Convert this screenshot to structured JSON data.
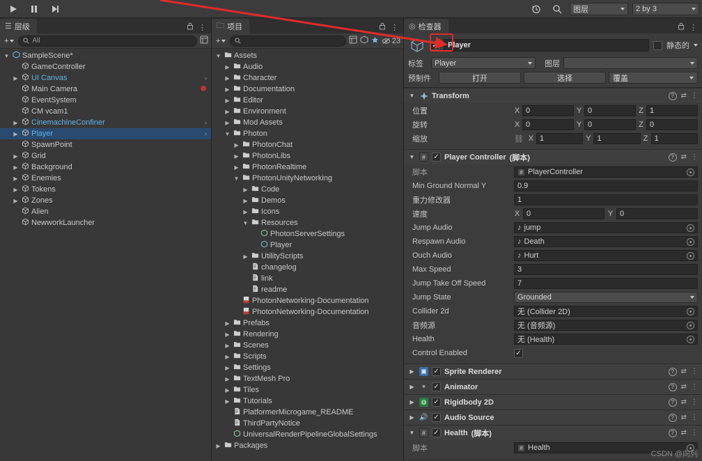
{
  "toolbar": {
    "play_icon": "play-icon",
    "pause_icon": "pause-icon",
    "step_icon": "step-icon",
    "history_icon": "history-icon",
    "search_icon": "search-icon",
    "layers_label": "图层",
    "layout_label": "2 by 3"
  },
  "hierarchy": {
    "tab_label": "层级",
    "tab_icon": "hierarchy-icon",
    "add_label": "+",
    "search_placeholder": "All",
    "lock_icon": "lock-icon",
    "menu_icon": "menu-icon",
    "items": [
      {
        "label": "SampleScene*",
        "depth": 0,
        "arrow": "▼",
        "icon": "scene-icon",
        "selected": false,
        "blue": false
      },
      {
        "label": "GameController",
        "depth": 1,
        "arrow": "",
        "icon": "cube-icon",
        "selected": false,
        "blue": false
      },
      {
        "label": "UI Canvas",
        "depth": 1,
        "arrow": "▶",
        "icon": "cube-icon",
        "selected": false,
        "blue": true
      },
      {
        "label": "Main Camera",
        "depth": 1,
        "arrow": "",
        "icon": "cube-icon",
        "selected": false,
        "blue": false
      },
      {
        "label": "EventSystem",
        "depth": 1,
        "arrow": "",
        "icon": "cube-icon",
        "selected": false,
        "blue": false
      },
      {
        "label": "CM vcam1",
        "depth": 1,
        "arrow": "",
        "icon": "cube-icon",
        "selected": false,
        "blue": false
      },
      {
        "label": "CinemachineConfiner",
        "depth": 1,
        "arrow": "▶",
        "icon": "cube-icon",
        "selected": false,
        "blue": true
      },
      {
        "label": "Player",
        "depth": 1,
        "arrow": "▶",
        "icon": "cube-icon",
        "selected": true,
        "blue": true
      },
      {
        "label": "SpawnPoint",
        "depth": 1,
        "arrow": "",
        "icon": "cube-icon",
        "selected": false,
        "blue": false
      },
      {
        "label": "Grid",
        "depth": 1,
        "arrow": "▶",
        "icon": "cube-icon",
        "selected": false,
        "blue": false
      },
      {
        "label": "Background",
        "depth": 1,
        "arrow": "▶",
        "icon": "cube-icon",
        "selected": false,
        "blue": false
      },
      {
        "label": "Enemies",
        "depth": 1,
        "arrow": "▶",
        "icon": "cube-icon",
        "selected": false,
        "blue": false
      },
      {
        "label": "Tokens",
        "depth": 1,
        "arrow": "▶",
        "icon": "cube-icon",
        "selected": false,
        "blue": false
      },
      {
        "label": "Zones",
        "depth": 1,
        "arrow": "▶",
        "icon": "cube-icon",
        "selected": false,
        "blue": false
      },
      {
        "label": "Alien",
        "depth": 1,
        "arrow": "",
        "icon": "cube-icon",
        "selected": false,
        "blue": false
      },
      {
        "label": "NewworkLauncher",
        "depth": 1,
        "arrow": "",
        "icon": "cube-icon",
        "selected": false,
        "blue": false
      }
    ]
  },
  "project": {
    "tab_label": "项目",
    "tab_icon": "project-icon",
    "add_label": "+",
    "search_placeholder": "",
    "count_badge": "23",
    "items": [
      {
        "label": "Assets",
        "depth": 0,
        "arrow": "▼",
        "icon": "folder"
      },
      {
        "label": "Audio",
        "depth": 1,
        "arrow": "▶",
        "icon": "folder"
      },
      {
        "label": "Character",
        "depth": 1,
        "arrow": "▶",
        "icon": "folder"
      },
      {
        "label": "Documentation",
        "depth": 1,
        "arrow": "▶",
        "icon": "folder"
      },
      {
        "label": "Editor",
        "depth": 1,
        "arrow": "▶",
        "icon": "folder"
      },
      {
        "label": "Environment",
        "depth": 1,
        "arrow": "▶",
        "icon": "folder"
      },
      {
        "label": "Mod Assets",
        "depth": 1,
        "arrow": "▶",
        "icon": "folder"
      },
      {
        "label": "Photon",
        "depth": 1,
        "arrow": "▼",
        "icon": "folder"
      },
      {
        "label": "PhotonChat",
        "depth": 2,
        "arrow": "▶",
        "icon": "folder"
      },
      {
        "label": "PhotonLibs",
        "depth": 2,
        "arrow": "▶",
        "icon": "folder"
      },
      {
        "label": "PhotonRealtime",
        "depth": 2,
        "arrow": "▶",
        "icon": "folder"
      },
      {
        "label": "PhotonUnityNetworking",
        "depth": 2,
        "arrow": "▼",
        "icon": "folder"
      },
      {
        "label": "Code",
        "depth": 3,
        "arrow": "▶",
        "icon": "folder"
      },
      {
        "label": "Demos",
        "depth": 3,
        "arrow": "▶",
        "icon": "folder"
      },
      {
        "label": "Icons",
        "depth": 3,
        "arrow": "▶",
        "icon": "folder"
      },
      {
        "label": "Resources",
        "depth": 3,
        "arrow": "▼",
        "icon": "folder"
      },
      {
        "label": "PhotonServerSettings",
        "depth": 4,
        "arrow": "",
        "icon": "asset"
      },
      {
        "label": "Player",
        "depth": 4,
        "arrow": "",
        "icon": "prefab"
      },
      {
        "label": "UtilityScripts",
        "depth": 3,
        "arrow": "▶",
        "icon": "folder"
      },
      {
        "label": "changelog",
        "depth": 3,
        "arrow": "",
        "icon": "textfile"
      },
      {
        "label": "link",
        "depth": 3,
        "arrow": "",
        "icon": "textfile"
      },
      {
        "label": "readme",
        "depth": 3,
        "arrow": "",
        "icon": "textfile"
      },
      {
        "label": "PhotonNetworking-Documentation",
        "depth": 2,
        "arrow": "",
        "icon": "pdf"
      },
      {
        "label": "PhotonNetworking-Documentation",
        "depth": 2,
        "arrow": "",
        "icon": "pdf"
      },
      {
        "label": "Prefabs",
        "depth": 1,
        "arrow": "▶",
        "icon": "folder"
      },
      {
        "label": "Rendering",
        "depth": 1,
        "arrow": "▶",
        "icon": "folder"
      },
      {
        "label": "Scenes",
        "depth": 1,
        "arrow": "▶",
        "icon": "folder"
      },
      {
        "label": "Scripts",
        "depth": 1,
        "arrow": "▶",
        "icon": "folder"
      },
      {
        "label": "Settings",
        "depth": 1,
        "arrow": "▶",
        "icon": "folder"
      },
      {
        "label": "TextMesh Pro",
        "depth": 1,
        "arrow": "▶",
        "icon": "folder"
      },
      {
        "label": "Tiles",
        "depth": 1,
        "arrow": "▶",
        "icon": "folder"
      },
      {
        "label": "Tutorials",
        "depth": 1,
        "arrow": "▶",
        "icon": "folder"
      },
      {
        "label": "PlatformerMicrogame_README",
        "depth": 1,
        "arrow": "",
        "icon": "textfile"
      },
      {
        "label": "ThirdPartyNotice",
        "depth": 1,
        "arrow": "",
        "icon": "textfile"
      },
      {
        "label": "UniversalRenderPipelineGlobalSettings",
        "depth": 1,
        "arrow": "",
        "icon": "asset"
      },
      {
        "label": "Packages",
        "depth": 0,
        "arrow": "▶",
        "icon": "folder"
      }
    ]
  },
  "inspector": {
    "tab_label": "检查器",
    "tab_icon": "inspector-icon",
    "lock_icon": "lock-icon",
    "menu_icon": "menu-icon",
    "object_name": "Player",
    "enabled": true,
    "static_label": "静态的",
    "static_checked": false,
    "tag_label": "标签",
    "tag_value": "Player",
    "layer_label": "图层",
    "layer_value": "",
    "prefab_label": "预制件",
    "prefab_open": "打开",
    "prefab_select": "选择",
    "prefab_override": "覆盖",
    "transform": {
      "title": "Transform",
      "position_label": "位置",
      "rotation_label": "旋转",
      "scale_label": "缩放",
      "position": {
        "x": "0",
        "y": "0",
        "z": "1"
      },
      "rotation": {
        "x": "0",
        "y": "0",
        "z": "0"
      },
      "scale": {
        "x": "1",
        "y": "1",
        "z": "1"
      }
    },
    "player_controller": {
      "title": "Player Controller",
      "title_suffix": "(脚本)",
      "enabled": true,
      "script_label": "脚本",
      "script_value": "PlayerController",
      "fields": [
        {
          "label": "Min Ground Normal Y",
          "value": "0.9",
          "type": "num"
        },
        {
          "label": "重力修改器",
          "value": "1",
          "type": "num"
        },
        {
          "label": "速度",
          "value": "",
          "type": "vec2",
          "x": "0",
          "y": "0"
        },
        {
          "label": "Jump Audio",
          "value": "jump",
          "type": "obj",
          "icon": "audio-icon"
        },
        {
          "label": "Respawn Audio",
          "value": "Death",
          "type": "obj",
          "icon": "audio-icon"
        },
        {
          "label": "Ouch Audio",
          "value": "Hurt",
          "type": "obj",
          "icon": "audio-icon"
        },
        {
          "label": "Max Speed",
          "value": "3",
          "type": "num"
        },
        {
          "label": "Jump Take Off Speed",
          "value": "7",
          "type": "num"
        },
        {
          "label": "Jump State",
          "value": "Grounded",
          "type": "dropdown"
        },
        {
          "label": "Collider 2d",
          "value": "无 (Collider 2D)",
          "type": "obj",
          "icon": "none"
        },
        {
          "label": "音频源",
          "value": "无 (音频源)",
          "type": "obj",
          "icon": "none"
        },
        {
          "label": "Health",
          "value": "无 (Health)",
          "type": "obj",
          "icon": "none"
        },
        {
          "label": "Control Enabled",
          "value": "✓",
          "type": "check"
        }
      ]
    },
    "components": [
      {
        "title": "Sprite Renderer",
        "enabled": true,
        "icon": "sprite-icon",
        "foldout": "▶"
      },
      {
        "title": "Animator",
        "enabled": true,
        "icon": "animator-icon",
        "foldout": "▶"
      },
      {
        "title": "Rigidbody 2D",
        "enabled": true,
        "icon": "rigidbody-icon",
        "foldout": "▶"
      },
      {
        "title": "Audio Source",
        "enabled": true,
        "icon": "audio-icon",
        "foldout": "▶"
      }
    ],
    "health": {
      "title": "Health",
      "title_suffix": "(脚本)",
      "enabled": true,
      "foldout": "▼",
      "script_label": "脚本",
      "script_value": "Health"
    }
  },
  "watermark": "CSDN @向列"
}
